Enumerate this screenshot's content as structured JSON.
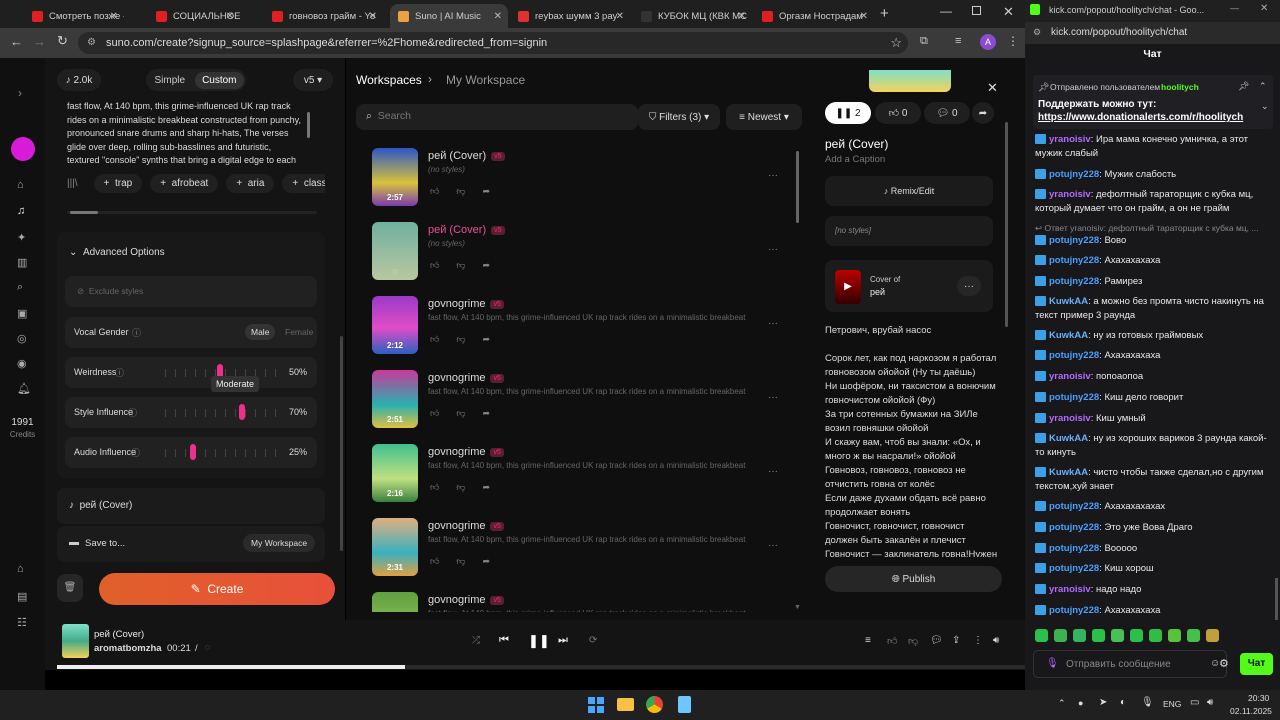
{
  "tabs": [
    {
      "label": "Смотреть позже - Yo",
      "color": "#e02020"
    },
    {
      "label": "СОЦИАЛЬНОЕ ДНО",
      "color": "#e02020"
    },
    {
      "label": "говновоз грайм - Yo",
      "color": "#e02020"
    },
    {
      "label": "Suno | AI Music",
      "color": "#f0a040"
    },
    {
      "label": "reybax шумм 3 рау",
      "color": "#e03030"
    },
    {
      "label": "КУБОК МЦ (КВК МС",
      "color": "#333"
    },
    {
      "label": "Оргазм Нострадам",
      "color": "#e02020"
    }
  ],
  "address_url": "suno.com/create?signup_source=splashpage&referrer=%2Fhome&redirected_from=signin",
  "profile_letter": "A",
  "rail": {
    "credits_num": "1991",
    "credits_label": "Credits"
  },
  "left": {
    "count": "2.0k",
    "simple": "Simple",
    "custom": "Custom",
    "version": "v5",
    "style_text": "fast flow, At 140 bpm, this grime-influenced UK rap track rides on a minimalistic breakbeat constructed from punchy, pronounced snare drums and sharp hi-hats, The verses glide over deep, rolling sub-basslines and futuristic, textured \"console\" synths that bring a digital edge to each section",
    "tags": [
      "trap",
      "afrobeat",
      "aria",
      "class"
    ],
    "advanced": "Advanced Options",
    "exclude_placeholder": "Exclude styles",
    "vocal_gender": "Vocal Gender",
    "male": "Male",
    "female": "Female",
    "weirdness": "Weirdness",
    "weirdness_val": "50%",
    "weirdness_frac": 0.5,
    "tooltip": "Moderate",
    "style_influence": "Style Influence",
    "style_val": "70%",
    "style_frac": 0.7,
    "audio_influence": "Audio Influence",
    "audio_val": "25%",
    "audio_frac": 0.25,
    "song_title": "рей (Cover)",
    "save_to": "Save to...",
    "workspace_btn": "My Workspace",
    "create": "Create"
  },
  "mid": {
    "breadcrumb_root": "Workspaces",
    "breadcrumb_current": "My Workspace",
    "search_placeholder": "Search",
    "filters": "Filters (3)",
    "sort": "Newest",
    "songs": [
      {
        "title": "рей (Cover)",
        "desc": "(no styles)",
        "dur": "2:57",
        "pink": false
      },
      {
        "title": "рей (Cover)",
        "desc": "(no styles)",
        "dur": "",
        "pink": true
      },
      {
        "title": "govnogrime",
        "desc": "fast flow, At 140 bpm, this grime-influenced UK rap track rides on a minimalistic breakbeat ...",
        "dur": "2:12",
        "pink": false
      },
      {
        "title": "govnogrime",
        "desc": "fast flow, At 140 bpm, this grime-influenced UK rap track rides on a minimalistic breakbeat ...",
        "dur": "2:51",
        "pink": false
      },
      {
        "title": "govnogrime",
        "desc": "fast flow, At 140 bpm, this grime-influenced UK rap track rides on a minimalistic breakbeat ...",
        "dur": "2:16",
        "pink": false
      },
      {
        "title": "govnogrime",
        "desc": "fast flow, At 140 bpm, this grime-influenced UK rap track rides on a minimalistic breakbeat ...",
        "dur": "2:31",
        "pink": false
      },
      {
        "title": "govnogrime",
        "desc": "fast flow, At 140 bpm, this grime-influenced UK rap track rides on a minimalistic breakbeat ...",
        "dur": "",
        "pink": false
      }
    ],
    "version_badge": "v5"
  },
  "right": {
    "play_count": "2",
    "likes": "0",
    "comments": "0",
    "title": "рей (Cover)",
    "caption_placeholder": "Add a Caption",
    "remix": "Remix/Edit",
    "no_styles": "[no styles]",
    "cover_of_label": "Cover of",
    "cover_of_title": "рей",
    "lyrics": "Петрович, врубай насос\n\nСорок лет, как под наркозом я работал говновозом ойойой (Ну ты даёшь)\nНи шофёром, ни таксистом а вонючим говночистом ойойой (Фу)\nЗа три сотенных бумажки на ЗИЛе возил говняшки ойойой\nИ скажу вам, чтоб вы знали: «Ох, и много ж вы насрали!» ойойой\nГовновоз, говновоз, говновоз не отчистить говна от колёс\nЕсли даже духами обдать всё равно продолжает вонять\nГовночист, говночист, говночист должен быть закалён и плечист\nГовночист — заклинатель говна!Нужен",
    "publish": "Publish"
  },
  "player": {
    "title": "рей (Cover)",
    "artist": "aromatbomzha",
    "time": "00:21",
    "sep": "/",
    "progress": 0.36
  },
  "chat": {
    "url": "kick.com/popout/hoolitych/chat - Goo...",
    "addr": "kick.com/popout/hoolitych/chat",
    "header": "Чат",
    "pinned_by": "Отправлено пользователем",
    "pinned_user": "hoolitych",
    "pinned_text": "Поддержать можно тут:",
    "pinned_link": "https://www.donationalerts.com/r/hoolitych",
    "messages": [
      {
        "u": "yranoisiv",
        "c": "#b36bff",
        "t": "Ира мама конечно умничка, а этот мужик слабый",
        "r": false
      },
      {
        "u": "potujny228",
        "c": "#4aa0ff",
        "t": "Мужик слабость",
        "r": false
      },
      {
        "u": "yranoisiv",
        "c": "#b36bff",
        "t": "дефолтный таратoрщик с кубка мц, который думает что он грайм, а он не грайм",
        "r": false
      },
      {
        "u": "Ответ yranoisiv: дефолтный таратoрщик с кубка мц, ...",
        "c": "#888",
        "t": "",
        "r": true
      },
      {
        "u": "potujny228",
        "c": "#4aa0ff",
        "t": "Вово",
        "r": false
      },
      {
        "u": "potujny228",
        "c": "#4aa0ff",
        "t": "Ахахахахаха",
        "r": false
      },
      {
        "u": "potujny228",
        "c": "#4aa0ff",
        "t": "Рамирез",
        "r": false
      },
      {
        "u": "KuwkAA",
        "c": "#6ab0ff",
        "t": "а можно без промта чисто накинуть на текст пример 3 раунда",
        "r": false
      },
      {
        "u": "KuwkAA",
        "c": "#6ab0ff",
        "t": "ну из готовых граймовых",
        "r": false
      },
      {
        "u": "potujny228",
        "c": "#4aa0ff",
        "t": "Ахахахахаха",
        "r": false
      },
      {
        "u": "yranoisiv",
        "c": "#b36bff",
        "t": "попоаопоа",
        "r": false
      },
      {
        "u": "potujny228",
        "c": "#4aa0ff",
        "t": "Киш дело говорит",
        "r": false
      },
      {
        "u": "yranoisiv",
        "c": "#b36bff",
        "t": "Киш умный",
        "r": false
      },
      {
        "u": "KuwkAA",
        "c": "#6ab0ff",
        "t": "ну из хороших вариков 3 раунда какой-то кинуть",
        "r": false
      },
      {
        "u": "KuwkAA",
        "c": "#6ab0ff",
        "t": "чисто чтобы также сделал,но с другим текстом,хуй знает",
        "r": false
      },
      {
        "u": "potujny228",
        "c": "#4aa0ff",
        "t": "Ахахахахахах",
        "r": false
      },
      {
        "u": "potujny228",
        "c": "#4aa0ff",
        "t": "Это уже Вова Драго",
        "r": false
      },
      {
        "u": "potujny228",
        "c": "#4aa0ff",
        "t": "Вооооо",
        "r": false
      },
      {
        "u": "potujny228",
        "c": "#4aa0ff",
        "t": "Киш хорош",
        "r": false
      },
      {
        "u": "yranoisiv",
        "c": "#b36bff",
        "t": "надо надо",
        "r": false
      },
      {
        "u": "potujny228",
        "c": "#4aa0ff",
        "t": "Ахахахахаха",
        "r": false
      }
    ],
    "send_placeholder": "Отправить сообщение",
    "send_btn": "Чат"
  },
  "taskbar": {
    "lang": "ENG",
    "time": "20:30",
    "date": "02.11.2025"
  }
}
